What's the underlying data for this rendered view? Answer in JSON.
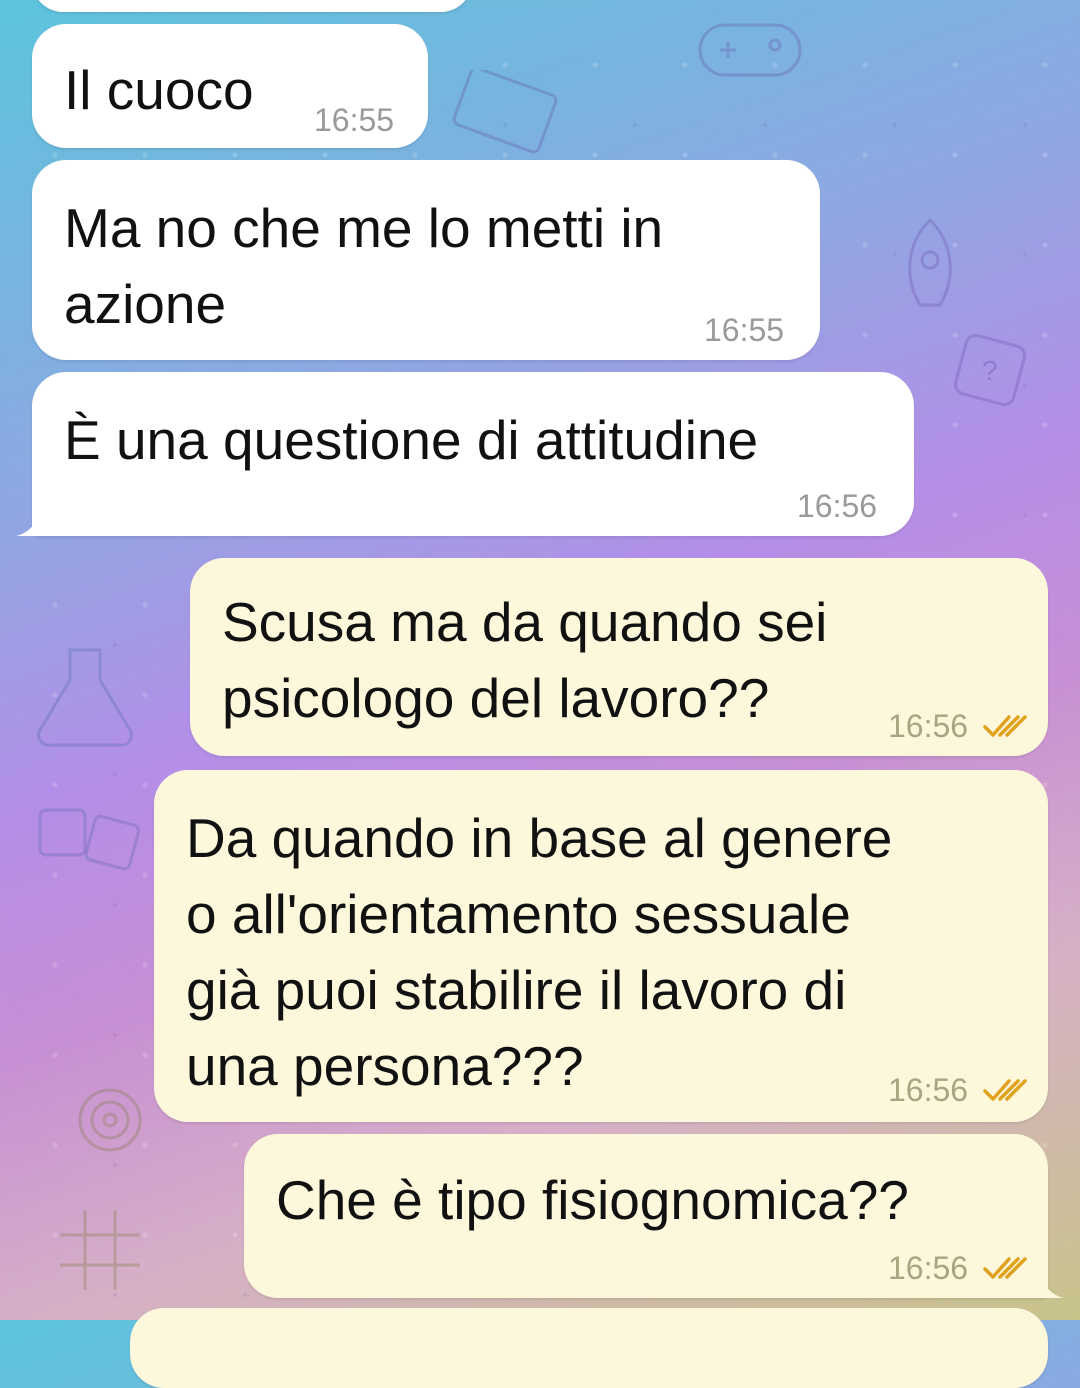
{
  "chat": {
    "messages": [
      {
        "direction": "incoming",
        "text": "",
        "time": ""
      },
      {
        "direction": "incoming",
        "text": "Il cuoco",
        "time": "16:55"
      },
      {
        "direction": "incoming",
        "text": "Ma no che me lo metti in\nazione",
        "time": "16:55"
      },
      {
        "direction": "incoming",
        "text": "È una questione di attitudine",
        "time": "16:56"
      },
      {
        "direction": "outgoing",
        "text": "Scusa ma da quando sei\npsicologo del lavoro??",
        "time": "16:56",
        "status": "read"
      },
      {
        "direction": "outgoing",
        "text": "Da quando in base al genere\no all'orientamento sessuale\ngià puoi stabilire il lavoro di\nuna persona???",
        "time": "16:56",
        "status": "read"
      },
      {
        "direction": "outgoing",
        "text": "Che è tipo fisiognomica??",
        "time": "16:56",
        "status": "read"
      },
      {
        "direction": "outgoing",
        "text": "",
        "time": ""
      }
    ]
  },
  "icons": {
    "read_receipt": "double-check-icon",
    "background": "doodle-pattern"
  },
  "colors": {
    "incoming_bubble": "#ffffff",
    "outgoing_bubble": "#fdf8dc",
    "read_check": "#e0a11c",
    "timestamp": "#9a9a9a"
  }
}
